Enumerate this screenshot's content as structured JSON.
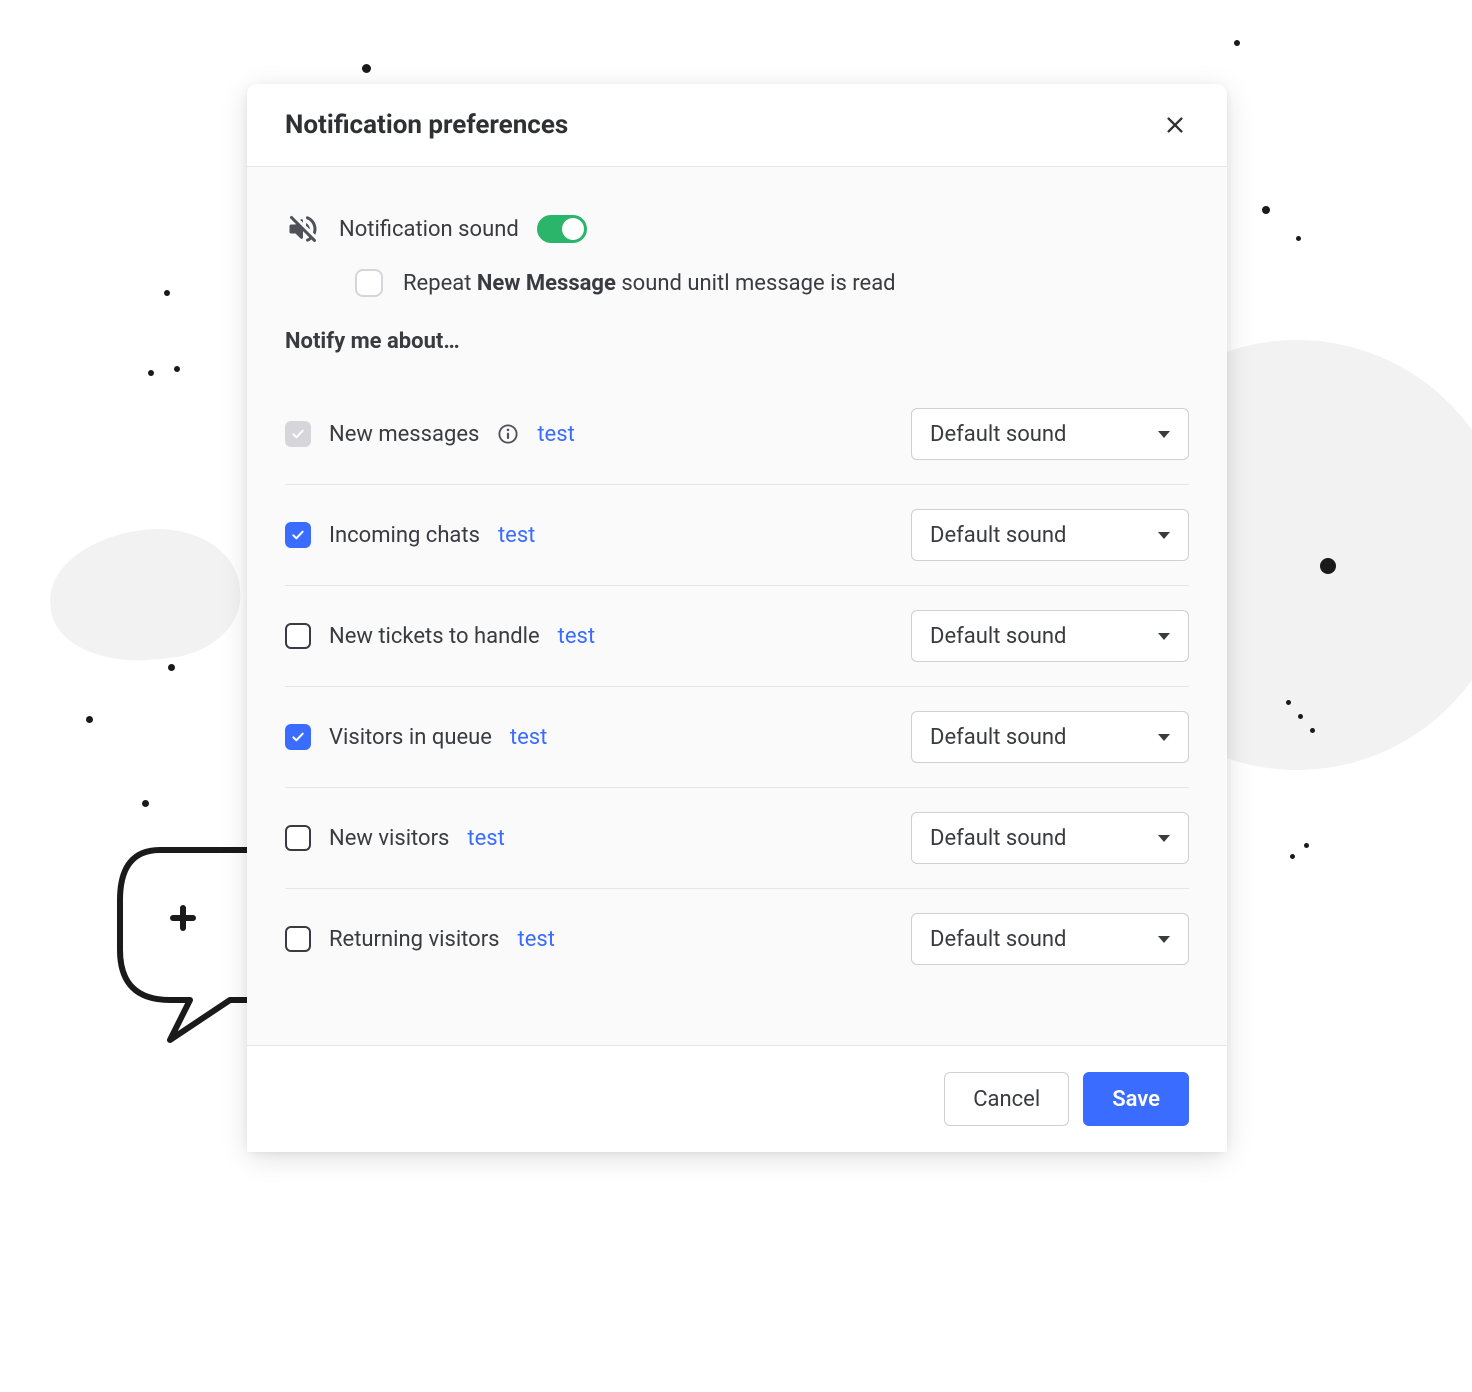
{
  "modal": {
    "title": "Notification preferences",
    "sound_label": "Notification sound",
    "sound_enabled": true,
    "repeat_prefix": "Repeat ",
    "repeat_bold": "New Message",
    "repeat_suffix": " sound unitl message is read",
    "section_title": "Notify me about…",
    "test_label": "test",
    "default_sound": "Default sound",
    "rows": [
      {
        "label": "New messages",
        "checked": true,
        "disabled": true,
        "has_info": true
      },
      {
        "label": "Incoming chats",
        "checked": true,
        "disabled": false,
        "has_info": false
      },
      {
        "label": "New tickets to handle",
        "checked": false,
        "disabled": false,
        "has_info": false
      },
      {
        "label": "Visitors in queue",
        "checked": true,
        "disabled": false,
        "has_info": false
      },
      {
        "label": "New visitors",
        "checked": false,
        "disabled": false,
        "has_info": false
      },
      {
        "label": "Returning visitors",
        "checked": false,
        "disabled": false,
        "has_info": false
      }
    ],
    "cancel": "Cancel",
    "save": "Save"
  }
}
